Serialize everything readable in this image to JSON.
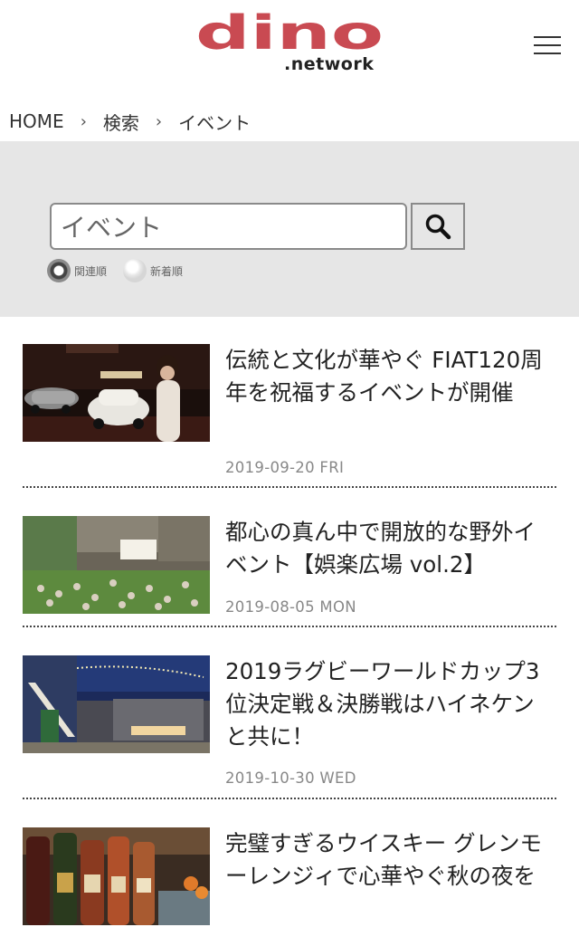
{
  "header": {
    "logo_main": "dino",
    "logo_sub": ".network",
    "brand_color": "#c94a52"
  },
  "breadcrumb": {
    "items": [
      "HOME",
      "検索",
      "イベント"
    ],
    "separator": "›"
  },
  "search": {
    "value": "イベント",
    "sort_options": [
      {
        "label": "関連順",
        "selected": true
      },
      {
        "label": "新着順",
        "selected": false
      }
    ]
  },
  "articles": [
    {
      "title": "伝統と文化が華やぐ FIAT120周年を祝福するイベントが開催",
      "date": "2019-09-20 FRI"
    },
    {
      "title": "都心の真ん中で開放的な野外イベント【娯楽広場 vol.2】",
      "date": "2019-08-05 MON"
    },
    {
      "title": "2019ラグビーワールドカップ3位決定戦＆決勝戦はハイネケンと共に！",
      "date": "2019-10-30 WED"
    },
    {
      "title": "完璧すぎるウイスキー グレンモーレンジィで心華やぐ秋の夜を",
      "date": ""
    }
  ]
}
